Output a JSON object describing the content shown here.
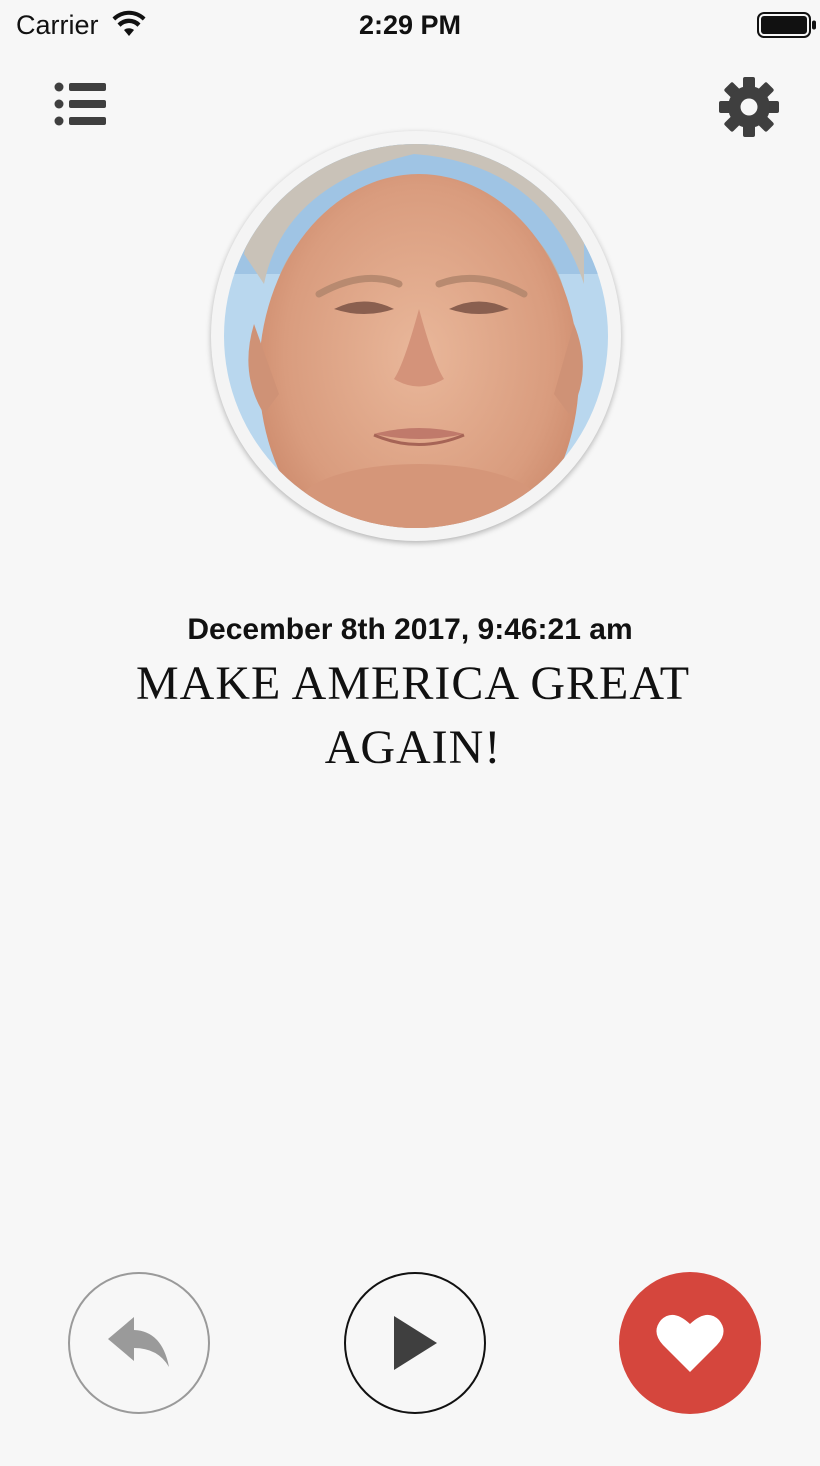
{
  "status_bar": {
    "carrier": "Carrier",
    "time": "2:29 PM",
    "wifi_icon": "wifi-icon",
    "battery_icon": "battery-icon"
  },
  "header": {
    "menu_icon": "list-icon",
    "settings_icon": "gear-icon"
  },
  "tweet": {
    "avatar_icon": "profile-photo",
    "timestamp": "December 8th 2017, 9:46:21 am",
    "text": "MAKE AMERICA GREAT AGAIN!"
  },
  "actions": {
    "reply_icon": "reply-arrow-icon",
    "play_icon": "play-icon",
    "like_icon": "heart-icon"
  },
  "colors": {
    "background": "#f7f7f7",
    "like_button": "#d5463d",
    "icon_dark": "#3f3f3f",
    "reply_border": "#9a9a9a"
  }
}
